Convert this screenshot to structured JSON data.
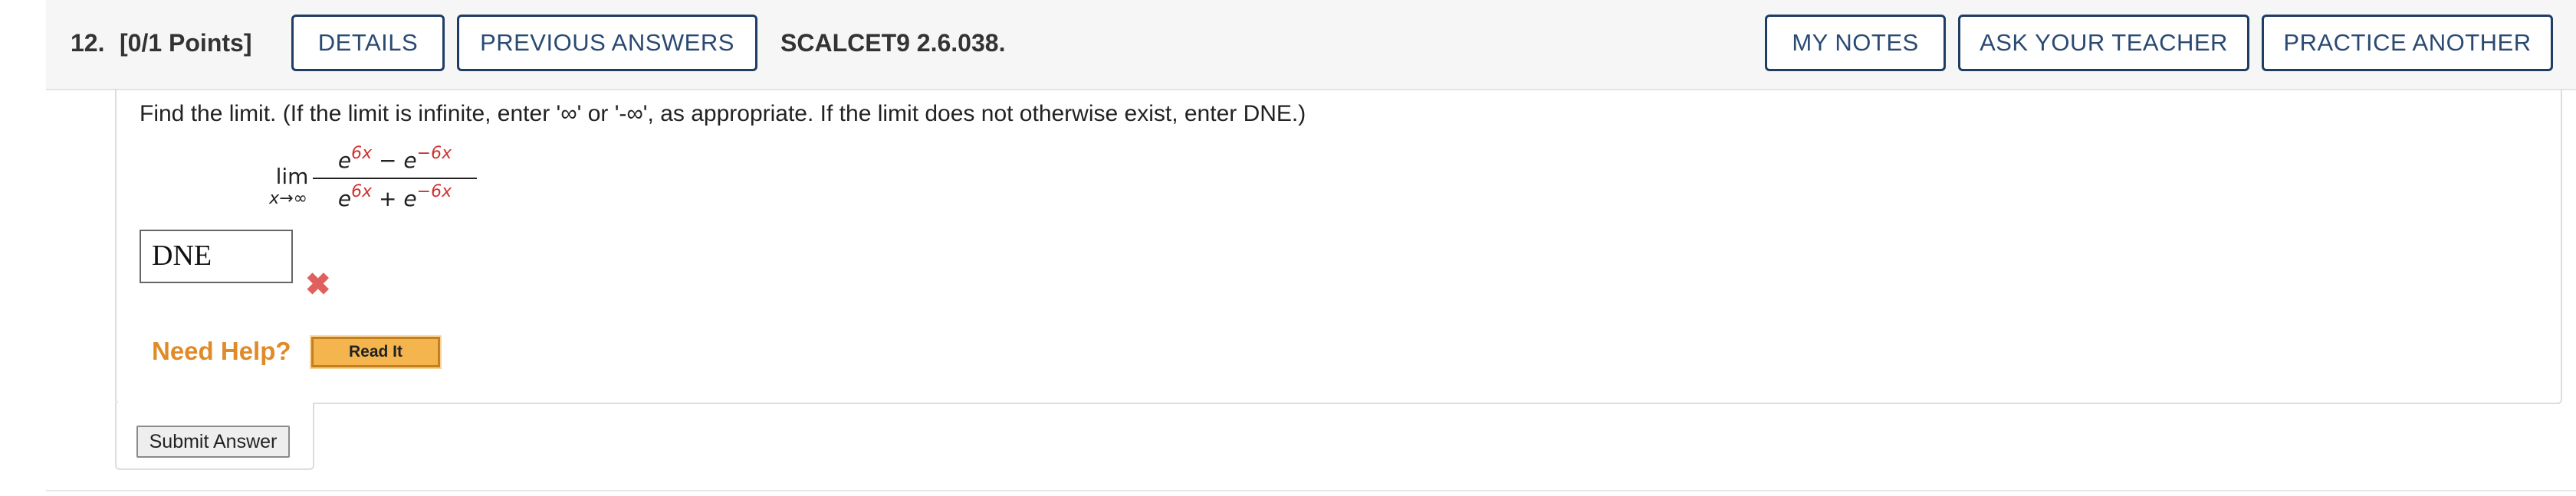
{
  "header": {
    "question_number": "12.",
    "points": "[0/1 Points]",
    "details_label": "DETAILS",
    "previous_answers_label": "PREVIOUS ANSWERS",
    "problem_code": "SCALCET9 2.6.038.",
    "my_notes_label": "MY NOTES",
    "ask_teacher_label": "ASK YOUR TEACHER",
    "practice_another_label": "PRACTICE ANOTHER"
  },
  "question": {
    "instructions": "Find the limit. (If the limit is infinite, enter '∞' or '-∞', as appropriate. If the limit does not otherwise exist, enter DNE.)",
    "math": {
      "lim": "lim",
      "lim_subscript": "x→∞",
      "numerator_base_1": "e",
      "numerator_exp_1": "6x",
      "numerator_op": " − ",
      "numerator_base_2": "e",
      "numerator_exp_2": "−6x",
      "denominator_base_1": "e",
      "denominator_exp_1": "6x",
      "denominator_op": " + ",
      "denominator_base_2": "e",
      "denominator_exp_2": "−6x"
    },
    "answer_value": "DNE",
    "answer_status": "incorrect",
    "wrong_mark_glyph": "✖"
  },
  "help": {
    "need_help_label": "Need Help?",
    "read_it_label": "Read It"
  },
  "submit": {
    "label": "Submit Answer"
  },
  "colors": {
    "button_border": "#1f3d63",
    "help_orange": "#e08a28",
    "wrong_red": "#e0605f",
    "exponent_red": "#d03030"
  }
}
